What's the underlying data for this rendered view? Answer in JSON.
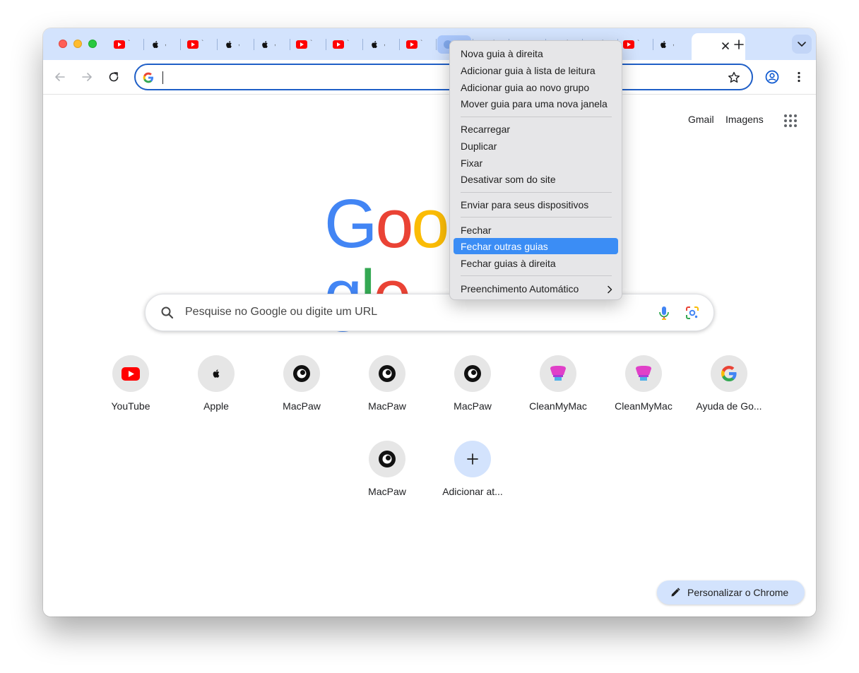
{
  "browser": {
    "tabs": [
      {
        "kind": "youtube",
        "tail": "`"
      },
      {
        "kind": "apple",
        "tail": ","
      },
      {
        "kind": "youtube",
        "tail": "`"
      },
      {
        "kind": "apple",
        "tail": ","
      },
      {
        "kind": "apple",
        "tail": ","
      },
      {
        "kind": "youtube",
        "tail": "`"
      },
      {
        "kind": "youtube",
        "tail": "`"
      },
      {
        "kind": "apple",
        "tail": ","
      },
      {
        "kind": "youtube",
        "tail": "`"
      },
      {
        "kind": "highlighted",
        "tail": ""
      },
      {
        "kind": "youtube",
        "tail": "`"
      },
      {
        "kind": "apple",
        "tail": ","
      },
      {
        "kind": "youtube",
        "tail": "`"
      },
      {
        "kind": "youtube",
        "tail": "`"
      },
      {
        "kind": "youtube",
        "tail": "`"
      },
      {
        "kind": "apple",
        "tail": ","
      }
    ],
    "omnibox_value": "",
    "icons": {
      "back": "arrow-left-icon",
      "forward": "arrow-right-icon",
      "reload": "reload-icon",
      "bookmark": "star-icon",
      "profile": "profile-icon",
      "menu": "more-vertical-icon",
      "tab_list": "chevron-down-icon",
      "new_tab": "plus-icon",
      "close_tab": "close-icon"
    }
  },
  "page": {
    "links": {
      "gmail": "Gmail",
      "images": "Imagens"
    },
    "logo_letters": [
      "G",
      "o",
      "o",
      "g",
      "l",
      "e"
    ],
    "logo_colors": [
      "#4285f4",
      "#ea4335",
      "#fbbc05",
      "#4285f4",
      "#34a853",
      "#ea4335"
    ],
    "search_placeholder": "Pesquise no Google ou digite um URL",
    "shortcuts": [
      {
        "label": "YouTube",
        "icon": "youtube-icon"
      },
      {
        "label": "Apple",
        "icon": "apple-icon"
      },
      {
        "label": "MacPaw",
        "icon": "macpaw-icon"
      },
      {
        "label": "MacPaw",
        "icon": "macpaw-icon"
      },
      {
        "label": "MacPaw",
        "icon": "macpaw-icon"
      },
      {
        "label": "CleanMyMac",
        "icon": "cleanmymac-icon"
      },
      {
        "label": "CleanMyMac",
        "icon": "cleanmymac-icon"
      },
      {
        "label": "Ayuda de Go...",
        "icon": "google-icon"
      },
      {
        "label": "MacPaw",
        "icon": "macpaw-icon"
      },
      {
        "label": "Adicionar at...",
        "icon": "plus-icon"
      }
    ],
    "customize_label": "Personalizar o Chrome"
  },
  "context_menu": {
    "items": [
      {
        "label": "Nova guia à direita"
      },
      {
        "label": "Adicionar guia à lista de leitura"
      },
      {
        "label": "Adicionar guia ao novo grupo"
      },
      {
        "label": "Mover guia para uma nova janela"
      },
      {
        "label": "Recarregar"
      },
      {
        "label": "Duplicar"
      },
      {
        "label": "Fixar"
      },
      {
        "label": "Desativar som do site"
      },
      {
        "label": "Enviar para seus dispositivos"
      },
      {
        "label": "Fechar"
      },
      {
        "label": "Fechar outras guias",
        "selected": true
      },
      {
        "label": "Fechar guias à direita"
      },
      {
        "label": "Preenchimento Automático",
        "submenu": true
      }
    ]
  },
  "colors": {
    "tabstrip": "#d3e3fd",
    "omnibox_focus": "#1f5fc7",
    "menu_selected": "#3b8df5",
    "youtube_red": "#ff0000",
    "cleanmymac_pink": "#e040c8"
  }
}
